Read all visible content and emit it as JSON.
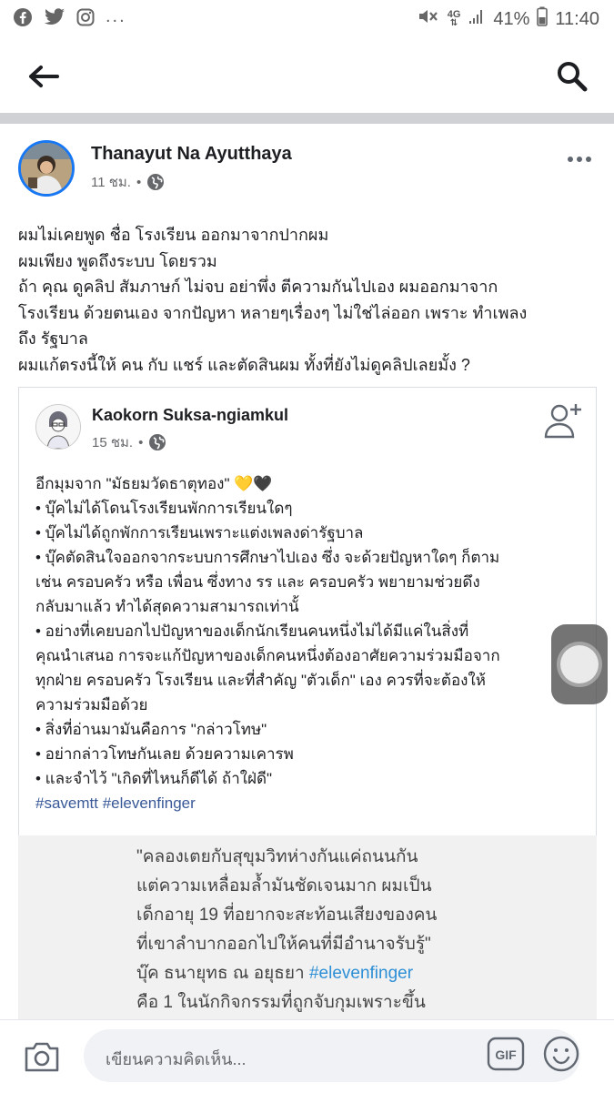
{
  "status_bar": {
    "notification_icons": [
      "facebook-icon",
      "twitter-icon",
      "instagram-icon"
    ],
    "more": "...",
    "network": "4G",
    "battery": "41%",
    "time": "11:40"
  },
  "post": {
    "author": "Thanayut Na Ayutthaya",
    "time": "11 ชม.",
    "separator": "•",
    "lines": [
      "ผมไม่เคยพูด ชื่อ โรงเรียน ออกมาจากปากผม",
      "ผมเพียง พูดถึงระบบ โดยรวม",
      "ถ้า คุณ ดูคลิป สัมภาษก์ ไม่จบ อย่าพึ่ง ตีความกันไปเอง ผมออกมาจาก",
      "โรงเรียน ด้วยตนเอง จากปัญหา หลายๆเรื่องๆ ไม่ใช่ไล่ออก เพราะ ทำเพลง",
      "ถึง รัฐบาล",
      "ผมแก้ตรงนี้ให้ คน กับ แชร์ และตัดสินผม ทั้งที่ยังไม่ดูคลิปเลยมั้ง ?"
    ]
  },
  "shared": {
    "author": "Kaokorn Suksa-ngiamkul",
    "time": "15 ชม.",
    "separator": "•",
    "lines": [
      "อีกมุมจาก \"มัธยมวัดธาตุทอง\" 💛🖤",
      "• บุ๊คไม่ได้โดนโรงเรียนพักการเรียนใดๆ",
      "• บุ๊คไม่ได้ถูกพักการเรียนเพราะแต่งเพลงด่ารัฐบาล",
      "• บุ๊คตัดสินใจออกจากระบบการศึกษาไปเอง ซึ่ง จะด้วยปัญหาใดๆ ก็ตาม",
      "เช่น ครอบครัว หรือ เพื่อน ซึ่งทาง รร และ ครอบครัว พยายามช่วยดึง",
      "กลับมาแล้ว ทำได้สุดความสามารถเท่านั้",
      "• อย่างที่เคยบอกไปปัญหาของเด็กนักเรียนคนหนึ่งไม่ได้มีแค่ในสิ่งที่",
      "คุณนำเสนอ การจะแก้ปัญหาของเด็กคนหนึ่งต้องอาศัยความร่วมมือจาก",
      "ทุกฝ่าย ครอบครัว โรงเรียน และที่สำคัญ \"ตัวเด็ก\" เอง ควรที่จะต้องให้",
      "ความร่วมมือด้วย",
      "• สิ่งที่อ่านมามันคือการ \"กล่าวโทษ\"",
      "• อย่ากล่าวโทษกันเลย ด้วยความเคารพ",
      "• และจำไว้ \"เกิดที่ไหนก็ดีได้ ถ้าใฝ่ดี\""
    ],
    "hashtags": "#savemtt #elevenfinger"
  },
  "image_preview": {
    "lines": [
      "\"คลองเตยกับสุขุมวิทห่างกันแค่ถนนกัน",
      "แต่ความเหลื่อมล้ำมันชัดเจนมาก ผมเป็น",
      "เด็กอายุ 19 ที่อยากจะสะท้อนเสียงของคน",
      "ที่เขาลำบากออกไปให้คนที่มีอำนาจรับรู้\""
    ],
    "line5_prefix": "บุ๊ค ธนายุทธ ณ อยุธยา ",
    "line5_tag": "#elevenfinger",
    "line6": "คือ 1 ในนักกิจกรรมที่ถูกจับกุมเพราะขึ้น"
  },
  "comment_bar": {
    "placeholder": "เขียนความคิดเห็น...",
    "gif_label": "GIF"
  },
  "colors": {
    "facebook_blue": "#1877f2",
    "link": "#385898",
    "divider": "#cfd1d4"
  }
}
